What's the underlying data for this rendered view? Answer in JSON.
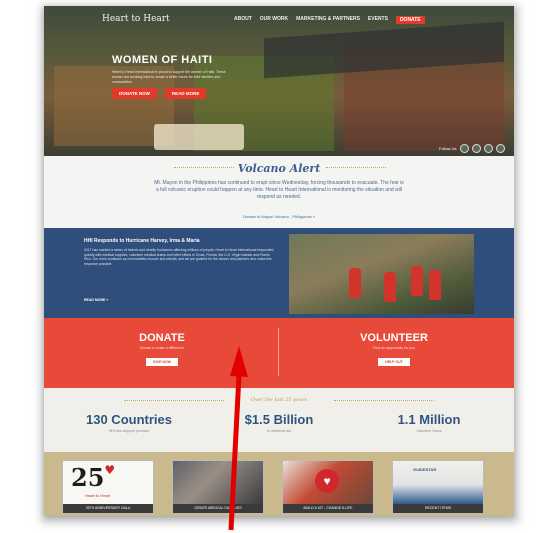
{
  "site": {
    "logo": "Heart to Heart",
    "nav": [
      "ABOUT",
      "OUR WORK",
      "MARKETING & PARTNERS",
      "EVENTS"
    ],
    "nav_donate": "DONATE"
  },
  "hero": {
    "title": "WOMEN OF HAITI",
    "text": "Heart to Heart International is proud to support the women of Haiti. These women are working hard to create a better future for their families and communities.",
    "btn_primary": "DONATE NOW",
    "btn_secondary": "READ MORE",
    "follow_label": "Follow Us"
  },
  "volcano": {
    "title": "Volcano Alert",
    "text": "Mt. Mayon in the Philippines has continued to erupt since Wednesday, forcing thousands to evacuate. The fear is a full volcanic eruption could happen at any time. Heart to Heart International is monitoring the situation and will respond as needed.",
    "link": "Donate to Mayon Volcano - Philippines »"
  },
  "news": {
    "title": "HHI Responds to Hurricane Harvey, Irma & Maria",
    "text": "2017 has marked a series of historic and deadly hurricanes affecting millions of people. Heart to Heart International responded quickly with medical supplies, volunteer medical teams and relief efforts in Texas, Florida, the U.S. Virgin Islands and Puerto Rico. Our work continues as communities recover and rebuild, and we are grateful for the donors and partners who make this response possible.",
    "more": "READ MORE »"
  },
  "actions": {
    "donate_title": "DONATE",
    "donate_sub": "Donate to make a difference",
    "donate_btn": "GIVE NOW",
    "volunteer_title": "VOLUNTEER",
    "volunteer_sub": "Find an opportunity for you",
    "volunteer_btn": "HELP OUT"
  },
  "stats": {
    "title": "Over the last 25 years",
    "items": [
      {
        "num": "130 Countries",
        "label": "HHI has shipped products"
      },
      {
        "num": "$1.5 Billion",
        "label": "In delivered aid"
      },
      {
        "num": "1.1 Million",
        "label": "Volunteer Hours"
      }
    ]
  },
  "tiles": [
    {
      "caption": "25TH ANNIVERSARY GALA",
      "big": "25",
      "sub": "Heart to Heart"
    },
    {
      "caption": "ORDER MEDICAL SUPPLIES"
    },
    {
      "caption": "BUILD A KIT - CHANGE A LIFE"
    },
    {
      "caption": "RECENT ITEMS",
      "brand": "GUIDESTAR"
    }
  ],
  "colors": {
    "accent_red": "#e84a3a",
    "navy": "#2f4e7c",
    "title_blue": "#3b5f8f",
    "gold": "#c6a954"
  }
}
